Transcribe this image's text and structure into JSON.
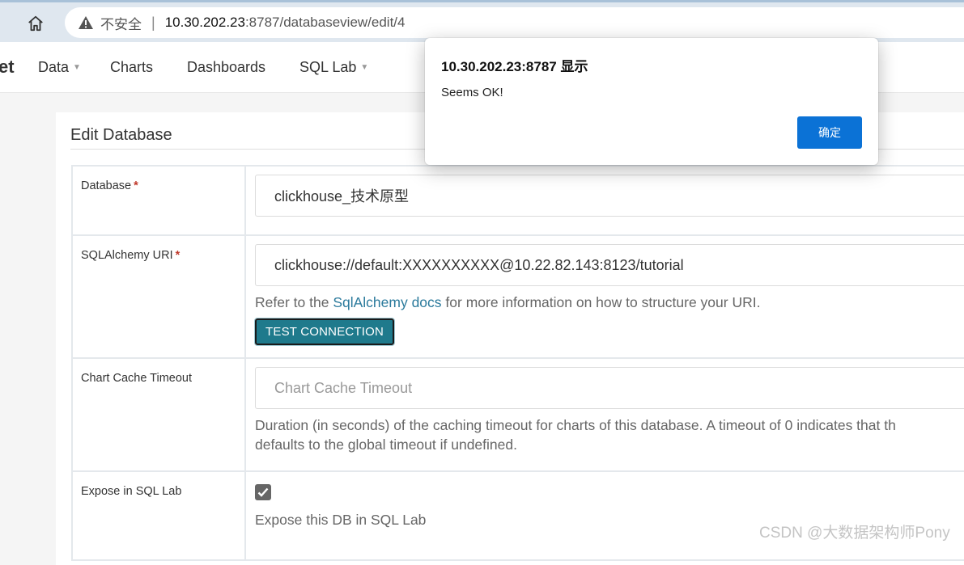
{
  "browser": {
    "insecure_label": "不安全",
    "url_host": "10.30.202.23",
    "url_rest": ":8787/databaseview/edit/4"
  },
  "nav": {
    "brand_tail": "et",
    "items": [
      {
        "label": "Data",
        "has_caret": true
      },
      {
        "label": "Charts",
        "has_caret": false
      },
      {
        "label": "Dashboards",
        "has_caret": false
      },
      {
        "label": "SQL Lab",
        "has_caret": true
      }
    ]
  },
  "panel": {
    "title": "Edit Database",
    "rows": {
      "database": {
        "label": "Database",
        "required_mark": "*",
        "value": "clickhouse_技术原型"
      },
      "uri": {
        "label": "SQLAlchemy URI",
        "required_mark": "*",
        "value": "clickhouse://default:XXXXXXXXXX@10.22.82.143:8123/tutorial",
        "help_prefix": "Refer to the ",
        "help_link": "SqlAlchemy docs",
        "help_suffix": " for more information on how to structure your URI.",
        "test_button": "TEST CONNECTION"
      },
      "cache": {
        "label": "Chart Cache Timeout",
        "placeholder": "Chart Cache Timeout",
        "help_line1": "Duration (in seconds) of the caching timeout for charts of this database. A timeout of 0 indicates that th",
        "help_line2": "defaults to the global timeout if undefined."
      },
      "expose": {
        "label": "Expose in SQL Lab",
        "checked": true,
        "help": "Expose this DB in SQL Lab"
      }
    }
  },
  "dialog": {
    "title": "10.30.202.23:8787 显示",
    "message": "Seems OK!",
    "ok_label": "确定"
  },
  "watermark": "CSDN @大数据架构师Pony",
  "colors": {
    "accent_button": "#1f7a8c",
    "dialog_button": "#0b72d6",
    "link": "#2b7a9c",
    "required": "#c0392b"
  }
}
